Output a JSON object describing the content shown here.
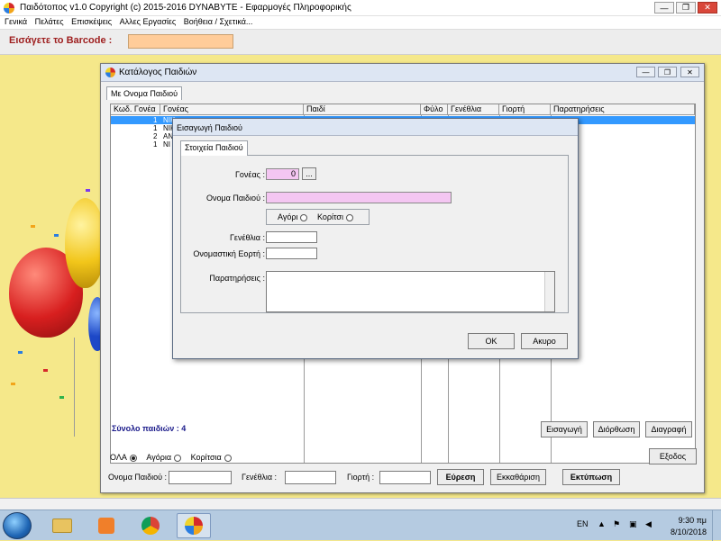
{
  "window": {
    "title": "Παιδότοπος  v1.0   Copyright (c) 2015-2016  DYNABYTE - Εφαρμογές Πληροφορικής",
    "minimize_glyph": "—",
    "maximize_glyph": "❐",
    "close_glyph": "✕"
  },
  "menu": [
    "Γενικά",
    "Πελάτες",
    "Επισκέψεις",
    "Αλλες Εργασίες",
    "Βοήθεια / Σχετικά..."
  ],
  "barcode": {
    "label": "Εισάγετε το Barcode :",
    "value": ""
  },
  "catalog": {
    "title": "Κατάλογος Παιδιών",
    "tab": "Με Ονομα Παιδιού",
    "columns": [
      "Κωδ. Γονέα",
      "Γονέας",
      "Παιδί",
      "Φύλο",
      "Γενέθλια",
      "Γιορτή",
      "Παρατηρήσεις"
    ],
    "rows": [
      {
        "code": "1",
        "parent": "ΝΙΚ"
      },
      {
        "code": "1",
        "parent": "ΝΙΚ"
      },
      {
        "code": "2",
        "parent": "ΑΝ"
      },
      {
        "code": "1",
        "parent": "ΝΙ"
      }
    ],
    "total_label": "Σύνολο παιδιών : 4",
    "buttons": {
      "insert": "Εισαγωγή",
      "edit": "Διόρθωση",
      "delete": "Διαγραφή",
      "exit": "Εξοδος"
    },
    "filter": {
      "all": "ΟΛΑ",
      "boys": "Αγόρια",
      "girls": "Κορίτσια"
    },
    "search": {
      "child_name_label": "Ονομα Παιδιού :",
      "birthday_label": "Γενέθλια :",
      "nameday_label": "Γιορτή :",
      "find": "Εύρεση",
      "clear": "Εκκαθάριση",
      "print": "Εκτύπωση"
    }
  },
  "dialog": {
    "title": "Εισαγωγή Παιδιού",
    "tab": "Στοιχεία Παιδιού",
    "parent_label": "Γονέας :",
    "parent_value": "0",
    "browse": "...",
    "child_name_label": "Ονομα Παιδιού :",
    "boy": "Αγόρι",
    "girl": "Κορίτσι",
    "birthday_label": "Γενέθλια :",
    "nameday_label": "Ονομαστική Εορτή :",
    "notes_label": "Παρατηρήσεις :",
    "ok": "OK",
    "cancel": "Ακυρο"
  },
  "taskbar": {
    "lang": "EN",
    "time": "9:30 πμ",
    "date": "8/10/2018"
  },
  "colors": {
    "background": "#f5e88a",
    "barcode_label": "#9e1e1e",
    "barcode_field": "#ffcc99",
    "dialog_field": "#f4c6f2",
    "selection": "#3399ff"
  }
}
